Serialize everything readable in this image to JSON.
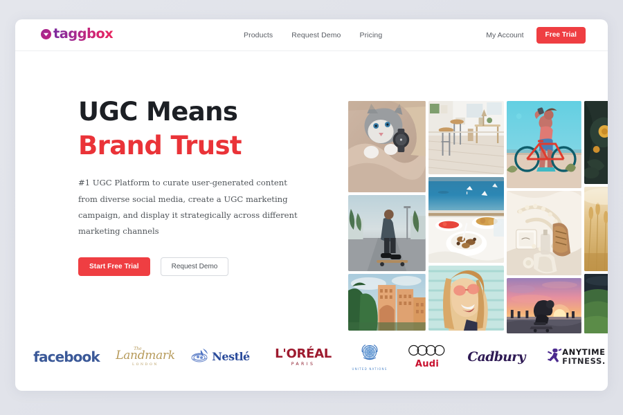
{
  "brand": {
    "logo_text": "taggbox",
    "logo_icon": "taggbox-circle-logo-icon",
    "accent_red": "#ef3e42",
    "logo_gradient_from": "#7b2a9d",
    "logo_gradient_to": "#e8275f"
  },
  "nav": {
    "links": [
      {
        "label": "Products",
        "name": "nav-link-products"
      },
      {
        "label": "Request Demo",
        "name": "nav-link-request-demo"
      },
      {
        "label": "Pricing",
        "name": "nav-link-pricing"
      }
    ],
    "account_label": "My Account",
    "free_trial_label": "Free Trial"
  },
  "hero": {
    "headline_line1": "UGC Means",
    "headline_line2": "Brand Trust",
    "subcopy": "#1 UGC Platform to curate user-generated content from diverse social media, create a UGC marketing campaign, and display it strategically across different marketing channels",
    "primary_cta": "Start Free Trial",
    "secondary_cta": "Request Demo"
  },
  "gallery": {
    "columns": [
      {
        "tiles": [
          {
            "name": "photo-tile-cat-and-watch",
            "alt": "Person in fur coat holding a grey tabby kitten, wearing a dark wristwatch"
          },
          {
            "name": "photo-tile-skateboarder-street",
            "alt": "Skateboarder crouching on a palm-lined city street"
          },
          {
            "name": "photo-tile-resort-palms",
            "alt": "Tropical resort hotel behind palm trees"
          }
        ]
      },
      {
        "tiles": [
          {
            "name": "photo-tile-cafe-interior",
            "alt": "Bright cafe interior with wooden stools and tables"
          },
          {
            "name": "photo-tile-brunch-seaside",
            "alt": "Breakfast bowls on a white table overlooking a blue bay"
          },
          {
            "name": "photo-tile-laughing-woman-sunglasses",
            "alt": "Laughing blonde woman in sunglasses against mint shutters"
          }
        ]
      },
      {
        "tiles": [
          {
            "name": "photo-tile-cyclist-beach",
            "alt": "Woman drinking from a bottle beside a red road bike on a beach"
          },
          {
            "name": "photo-tile-flatlay-pearls-shoes",
            "alt": "Flat lay of pearls, perfume and heeled sandals on cream fabric"
          },
          {
            "name": "photo-tile-skater-sunset",
            "alt": "Skateboarder at a sunset skatepark with pink and orange sky"
          }
        ]
      },
      {
        "tiles": [
          {
            "name": "photo-tile-dark-florals",
            "alt": "Moody dark floral arrangement with yellow blooms"
          },
          {
            "name": "photo-tile-golden-wheat-field",
            "alt": "Golden wheat field in warm backlight"
          },
          {
            "name": "photo-tile-green-hills",
            "alt": "Green rolling hills under dark sky"
          }
        ]
      }
    ]
  },
  "brands": {
    "heading": "",
    "items": [
      {
        "name": "brand-logo-facebook",
        "label": "facebook",
        "color": "#3b5998"
      },
      {
        "name": "brand-logo-the-landmark-london",
        "label": "Landmark",
        "prefix": "The",
        "sub": "LONDON",
        "color": "#b79b5b"
      },
      {
        "name": "brand-logo-nestle",
        "label": "Nestlé",
        "color": "#2a4b9b"
      },
      {
        "name": "brand-logo-loreal-paris",
        "label": "L'ORÉAL",
        "sub": "PARIS",
        "color": "#9e1b2f"
      },
      {
        "name": "brand-logo-united-nations",
        "label": "",
        "sub": "UNITED NATIONS",
        "color": "#4e86c9"
      },
      {
        "name": "brand-logo-audi",
        "label": "Audi",
        "color": "#c8102e"
      },
      {
        "name": "brand-logo-cadbury",
        "label": "Cadbury",
        "color": "#2e1a54"
      },
      {
        "name": "brand-logo-anytime-fitness",
        "label": "ANYTIME",
        "sub": "FITNESS.",
        "color": "#4b2a8e"
      }
    ]
  }
}
